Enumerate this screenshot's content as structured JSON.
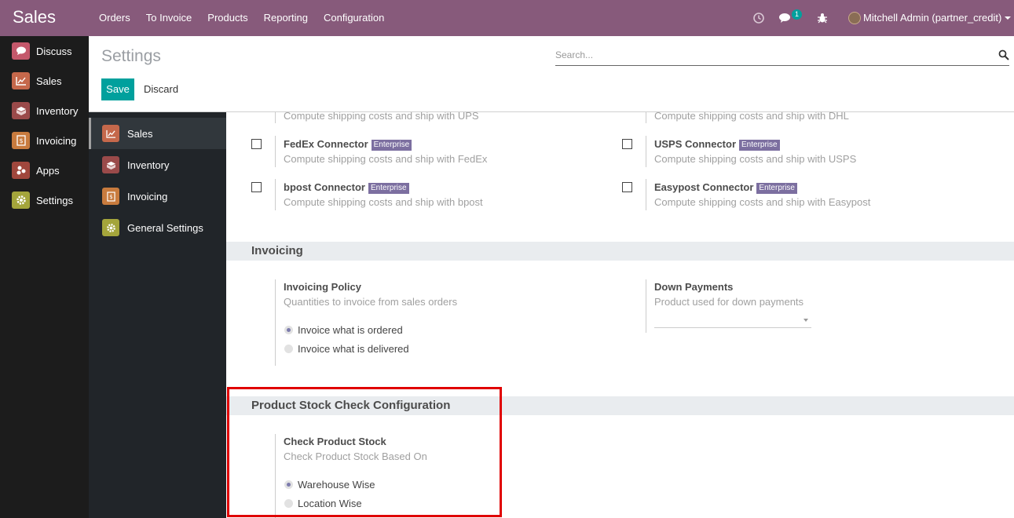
{
  "app": {
    "title": "Sales",
    "menu": [
      "Orders",
      "To Invoice",
      "Products",
      "Reporting",
      "Configuration"
    ],
    "messages_count": "1",
    "user": "Mitchell Admin (partner_credit)"
  },
  "apps_menu": [
    {
      "label": "Discuss",
      "icon": "discuss-icon",
      "color": "#c4586b"
    },
    {
      "label": "Sales",
      "icon": "sales-chart-icon",
      "color": "#c5684b"
    },
    {
      "label": "Inventory",
      "icon": "inventory-box-icon",
      "color": "#9a4a4a"
    },
    {
      "label": "Invoicing",
      "icon": "invoice-icon",
      "color": "#c87b3e"
    },
    {
      "label": "Apps",
      "icon": "apps-icon",
      "color": "#a0473d"
    },
    {
      "label": "Settings",
      "icon": "gear-icon",
      "color": "#a4a53b"
    }
  ],
  "control_panel": {
    "title": "Settings",
    "search_placeholder": "Search...",
    "save_label": "Save",
    "discard_label": "Discard"
  },
  "settings_nav": [
    {
      "label": "Sales",
      "icon": "sales-chart-icon",
      "color": "#c5684b",
      "active": true
    },
    {
      "label": "Inventory",
      "icon": "inventory-box-icon",
      "color": "#9a4a4a",
      "active": false
    },
    {
      "label": "Invoicing",
      "icon": "invoice-icon",
      "color": "#c87b3e",
      "active": false
    },
    {
      "label": "General Settings",
      "icon": "gear-icon",
      "color": "#a4a53b",
      "active": false
    }
  ],
  "shipping": {
    "ups_desc": "Compute shipping costs and ship with UPS",
    "dhl_desc": "Compute shipping costs and ship with DHL",
    "fedex": {
      "title": "FedEx Connector",
      "badge": "Enterprise",
      "desc": "Compute shipping costs and ship with FedEx"
    },
    "usps": {
      "title": "USPS Connector",
      "badge": "Enterprise",
      "desc": "Compute shipping costs and ship with USPS"
    },
    "bpost": {
      "title": "bpost Connector",
      "badge": "Enterprise",
      "desc": "Compute shipping costs and ship with bpost"
    },
    "easypost": {
      "title": "Easypost Connector",
      "badge": "Enterprise",
      "desc": "Compute shipping costs and ship with Easypost"
    }
  },
  "invoicing": {
    "heading": "Invoicing",
    "policy_title": "Invoicing Policy",
    "policy_desc": "Quantities to invoice from sales orders",
    "options": [
      "Invoice what is ordered",
      "Invoice what is delivered"
    ],
    "selected": "Invoice what is ordered",
    "down_title": "Down Payments",
    "down_desc": "Product used for down payments"
  },
  "stock_check": {
    "heading": "Product Stock Check Configuration",
    "title": "Check Product Stock",
    "desc": "Check Product Stock Based On",
    "options": [
      "Warehouse Wise",
      "Location Wise"
    ],
    "selected": "Warehouse Wise"
  }
}
